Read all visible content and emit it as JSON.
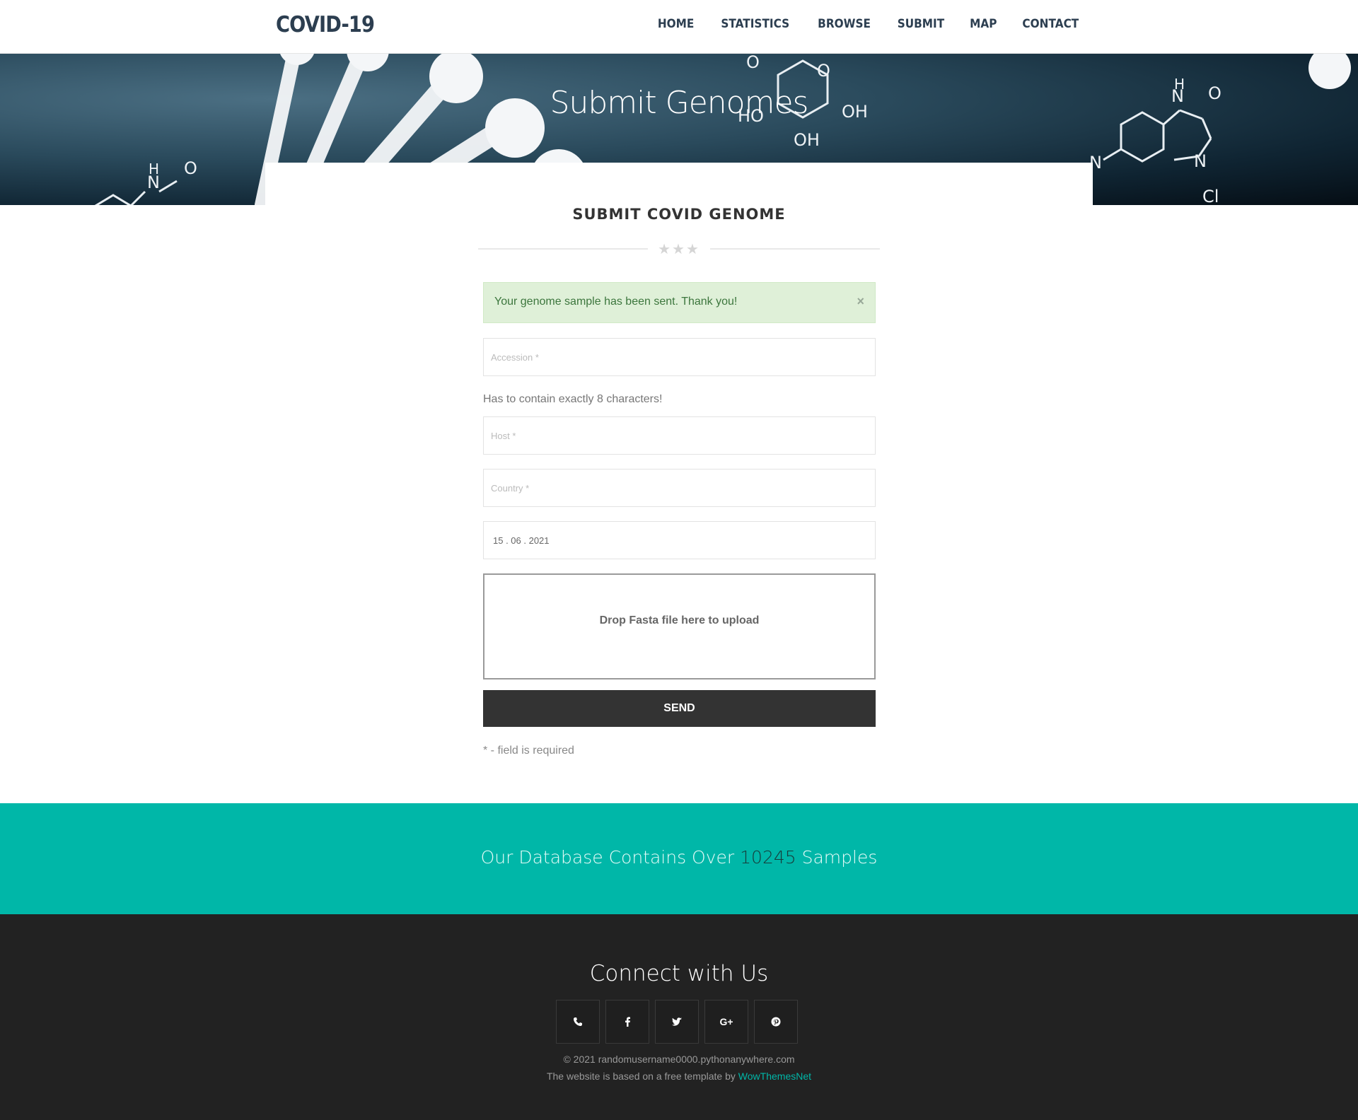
{
  "brand": "COVID-19",
  "nav": [
    "HOME",
    "STATISTICS",
    "BROWSE",
    "SUBMIT",
    "MAP",
    "CONTACT"
  ],
  "hero": {
    "title": "Submit Genomes"
  },
  "form": {
    "title": "SUBMIT COVID GENOME",
    "alert": "Your genome sample has been sent. Thank you!",
    "alert_close": "×",
    "accession_placeholder": "Accession *",
    "accession_hint": "Has to contain exactly 8 characters!",
    "host_placeholder": "Host *",
    "country_placeholder": "Country *",
    "date_value": "15 . 06 . 2021",
    "dropzone_label": "Drop Fasta file here to upload",
    "send_label": "SEND",
    "required_note": "* - field is required"
  },
  "stats": {
    "prefix": "Our Database Contains Over ",
    "count": "10245",
    "suffix": " Samples"
  },
  "footer": {
    "heading": "Connect with Us",
    "social_icons": [
      "phone-icon",
      "facebook-icon",
      "twitter-icon",
      "google-plus-icon",
      "pinterest-icon"
    ],
    "copyright": "© 2021 randomusername0000.pythonanywhere.com",
    "credit_text": "The website is based on a free template by ",
    "credit_link": "WowThemesNet"
  },
  "colors": {
    "accent": "#00b7a8",
    "navy": "#2c3e50",
    "footer": "#222222",
    "button": "#333333"
  }
}
